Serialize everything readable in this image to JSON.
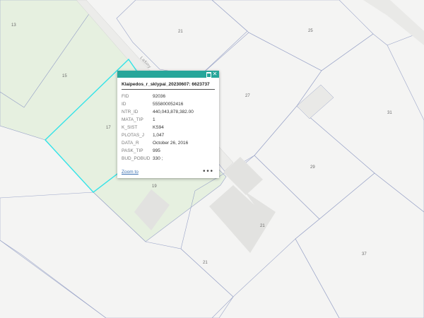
{
  "parcel_labels": [
    {
      "id": "p13",
      "text": "13"
    },
    {
      "id": "p21a",
      "text": "21"
    },
    {
      "id": "p25",
      "text": "25"
    },
    {
      "id": "p15",
      "text": "15"
    },
    {
      "id": "p27",
      "text": "27"
    },
    {
      "id": "p31",
      "text": "31"
    },
    {
      "id": "p17",
      "text": "17"
    },
    {
      "id": "p29",
      "text": "29"
    },
    {
      "id": "p19",
      "text": "19"
    },
    {
      "id": "p21b",
      "text": "21"
    },
    {
      "id": "p21c",
      "text": "21"
    },
    {
      "id": "p37",
      "text": "37"
    }
  ],
  "street_label": "Lašiny",
  "colors": {
    "background": "#f4f4f3",
    "green_parcel": "#e6f0e0",
    "building": "#e2e2e0",
    "parcel_line": "#9aa4c8",
    "selection": "#34e3e8",
    "popup_header": "#27a69a"
  },
  "popup": {
    "title": "Klaipedos_r_sklypai_20230607: 6623737",
    "attributes": [
      {
        "key": "FID",
        "value": "92036"
      },
      {
        "key": "ID",
        "value": "555800052416"
      },
      {
        "key": "NTR_ID",
        "value": "440,043,878,382.00"
      },
      {
        "key": "MATA_TIP",
        "value": "1"
      },
      {
        "key": "K_SIST",
        "value": "KS94"
      },
      {
        "key": "PLOTAS_J",
        "value": "1,047"
      },
      {
        "key": "DATA_R",
        "value": "October 26, 2016"
      },
      {
        "key": "PASK_TIP",
        "value": "995"
      },
      {
        "key": "BUD_POBUD",
        "value": "330 ;"
      }
    ],
    "zoom_label": "Zoom to",
    "more_label": "•••",
    "close_label": "✕",
    "maximize_icon": "maximize-icon"
  }
}
